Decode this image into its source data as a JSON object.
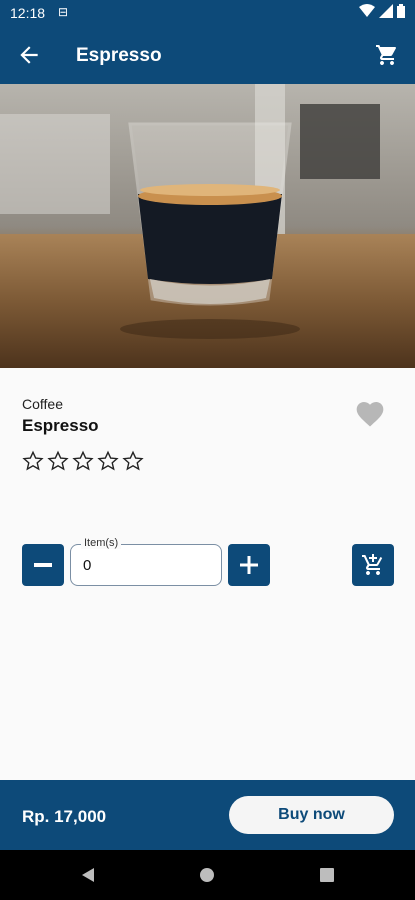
{
  "status_bar": {
    "time": "12:18",
    "sim_label": "⊟"
  },
  "app_bar": {
    "title": "Espresso"
  },
  "product": {
    "category": "Coffee",
    "name": "Espresso",
    "rating": 0,
    "rating_max": 5
  },
  "quantity": {
    "label": "Item(s)",
    "value": "0"
  },
  "footer": {
    "price": "Rp. 17,000",
    "buy_label": "Buy now"
  },
  "colors": {
    "primary": "#0d4a79",
    "background": "#fafafa",
    "button_bg": "#f5f5f5"
  },
  "icons": [
    "back-arrow-icon",
    "cart-icon",
    "favorite-heart-icon",
    "star-outline-icon",
    "minus-icon",
    "plus-icon",
    "add-to-cart-icon",
    "nav-back-icon",
    "nav-home-icon",
    "nav-recents-icon"
  ]
}
